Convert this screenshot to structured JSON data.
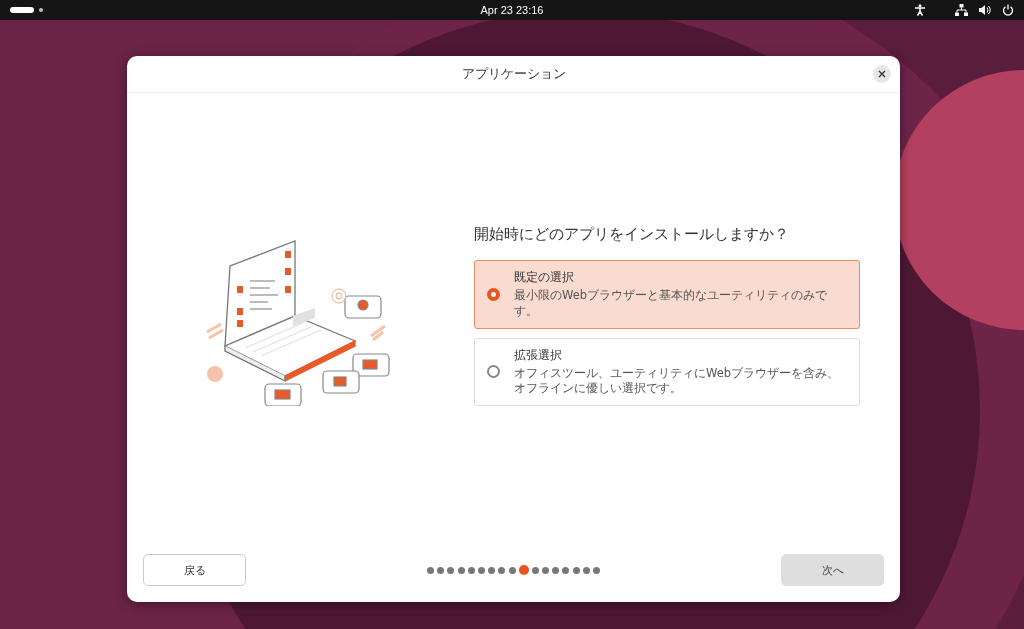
{
  "top_bar": {
    "clock": "Apr 23  23:16"
  },
  "window": {
    "title": "アプリケーション"
  },
  "question": "開始時にどのアプリをインストールしますか？",
  "options": [
    {
      "title": "既定の選択",
      "description": "最小限のWebブラウザーと基本的なユーティリティのみです。",
      "selected": true
    },
    {
      "title": "拡張選択",
      "description": "オフィスツール、ユーティリティにWebブラウザーを含み、オフラインに優しい選択です。",
      "selected": false
    }
  ],
  "back_button": {
    "label": "戻る",
    "disabled": false
  },
  "next_button": {
    "label": "次へ",
    "disabled": true
  },
  "steps": [
    {
      "selected": false
    },
    {
      "selected": false
    },
    {
      "selected": false
    },
    {
      "selected": false
    },
    {
      "selected": false
    },
    {
      "selected": false
    },
    {
      "selected": false
    },
    {
      "selected": false
    },
    {
      "selected": false
    },
    {
      "selected": true
    },
    {
      "selected": false
    },
    {
      "selected": false
    },
    {
      "selected": false
    },
    {
      "selected": false
    },
    {
      "selected": false
    },
    {
      "selected": false
    },
    {
      "selected": false
    }
  ]
}
